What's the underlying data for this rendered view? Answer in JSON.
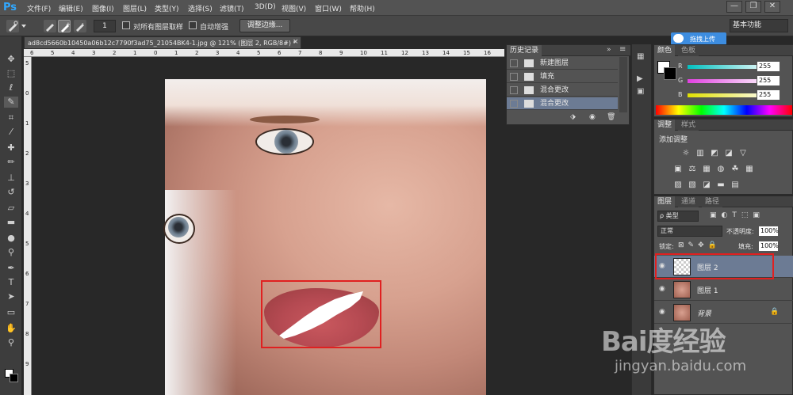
{
  "app": {
    "logo": "Ps",
    "menu": [
      "文件(F)",
      "编辑(E)",
      "图像(I)",
      "图层(L)",
      "类型(Y)",
      "选择(S)",
      "滤镜(T)",
      "3D(D)",
      "视图(V)",
      "窗口(W)",
      "帮助(H)"
    ],
    "window_controls": [
      "—",
      "❐",
      "✕"
    ]
  },
  "options_bar": {
    "brush_size": "1",
    "sample_all_layers": "对所有图层取样",
    "auto_enhance": "自动增强",
    "refine_edge": "调整边缘...",
    "upload_button": "拖拽上传",
    "workspace": "基本功能"
  },
  "document": {
    "tab_title": "ad8cd5660b10450a06b12c7790f3ad75_21054BK4-1.jpg @ 121% (图层 2, RGB/8#) *",
    "tab_close": "×",
    "ruler_marks": [
      "6",
      "5",
      "4",
      "3",
      "2",
      "1",
      "0",
      "1",
      "2",
      "3",
      "4",
      "5",
      "6",
      "7",
      "8",
      "9",
      "10",
      "11",
      "12",
      "13",
      "14",
      "15",
      "16"
    ],
    "ruler_v_marks": [
      "5",
      "0",
      "1",
      "2",
      "3",
      "4",
      "5",
      "6",
      "7",
      "8",
      "9"
    ]
  },
  "history_panel": {
    "title": "历史记录",
    "items": [
      "新建图层",
      "填充",
      "混合更改",
      "混合更改"
    ],
    "selected_index": 3
  },
  "color_panel": {
    "tabs": [
      "颜色",
      "色板"
    ],
    "channels": [
      {
        "label": "R",
        "value": "255",
        "color": "#00c0c0"
      },
      {
        "label": "G",
        "value": "255",
        "color": "#e040e0"
      },
      {
        "label": "B",
        "value": "255",
        "color": "#e0e000"
      }
    ]
  },
  "adjust_panel": {
    "tabs": [
      "调整",
      "样式"
    ],
    "title": "添加调整",
    "row1": [
      "☼",
      "▥",
      "◩",
      "◪",
      "▽"
    ],
    "row2": [
      "▣",
      "⚖",
      "▦",
      "◍",
      "☘",
      "▦"
    ],
    "row3": [
      "▨",
      "▧",
      "◪",
      "▬",
      "▤"
    ]
  },
  "layers_panel": {
    "tabs": [
      "图层",
      "通道",
      "路径"
    ],
    "filter": "ρ 类型",
    "blend_mode": "正常",
    "opacity_label": "不透明度:",
    "opacity_value": "100%",
    "lock_label": "锁定:",
    "fill_label": "填充:",
    "fill_value": "100%",
    "layers": [
      {
        "name": "图层 2",
        "selected": true
      },
      {
        "name": "图层 1",
        "selected": false
      },
      {
        "name": "背景",
        "selected": false,
        "locked": true
      }
    ]
  },
  "watermark": {
    "logo": "Bai度经验",
    "url": "jingyan.baidu.com"
  },
  "colors": {
    "accent": "#31a8ff",
    "selection": "#e02020",
    "panel": "#535353"
  }
}
